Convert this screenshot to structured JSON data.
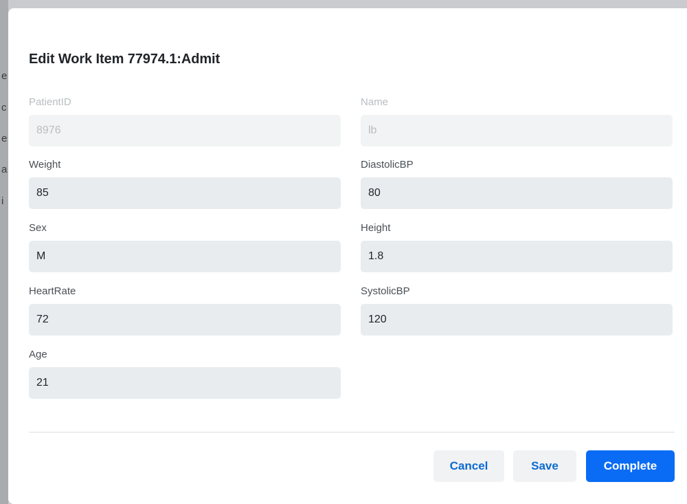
{
  "backdrop": {
    "chars": [
      "e",
      "c",
      "e",
      "a",
      "i"
    ]
  },
  "modal": {
    "title": "Edit Work Item 77974.1:Admit"
  },
  "fields": {
    "patient_id": {
      "label": "PatientID",
      "value": "8976",
      "disabled": true
    },
    "name": {
      "label": "Name",
      "value": "lb",
      "disabled": true
    },
    "weight": {
      "label": "Weight",
      "value": "85"
    },
    "diastolic_bp": {
      "label": "DiastolicBP",
      "value": "80"
    },
    "sex": {
      "label": "Sex",
      "value": "M"
    },
    "height": {
      "label": "Height",
      "value": "1.8"
    },
    "heart_rate": {
      "label": "HeartRate",
      "value": "72"
    },
    "systolic_bp": {
      "label": "SystolicBP",
      "value": "120"
    },
    "age": {
      "label": "Age",
      "value": "21"
    }
  },
  "actions": {
    "cancel_label": "Cancel",
    "save_label": "Save",
    "complete_label": "Complete"
  },
  "colors": {
    "primary": "#0a6cf5",
    "link": "#0b6bd1",
    "input_bg": "#e9ecef"
  }
}
